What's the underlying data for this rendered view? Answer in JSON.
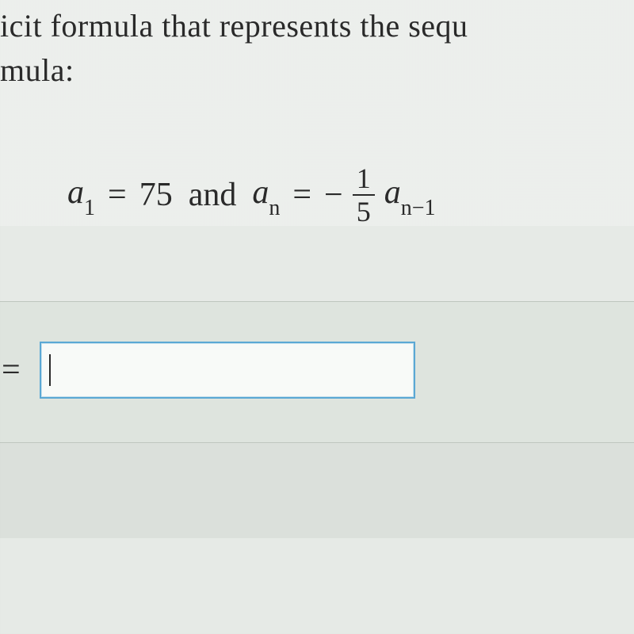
{
  "question": {
    "line1_partial": "icit formula that represents the sequ",
    "line2_partial": "mula:"
  },
  "formula": {
    "a1_var": "a",
    "a1_sub": "1",
    "a1_value": "75",
    "and_text": "and",
    "an_var": "a",
    "an_sub": "n",
    "frac_num": "1",
    "frac_den": "5",
    "prev_var": "a",
    "prev_sub": "n−1"
  },
  "answer": {
    "equals": "=",
    "input_value": ""
  }
}
